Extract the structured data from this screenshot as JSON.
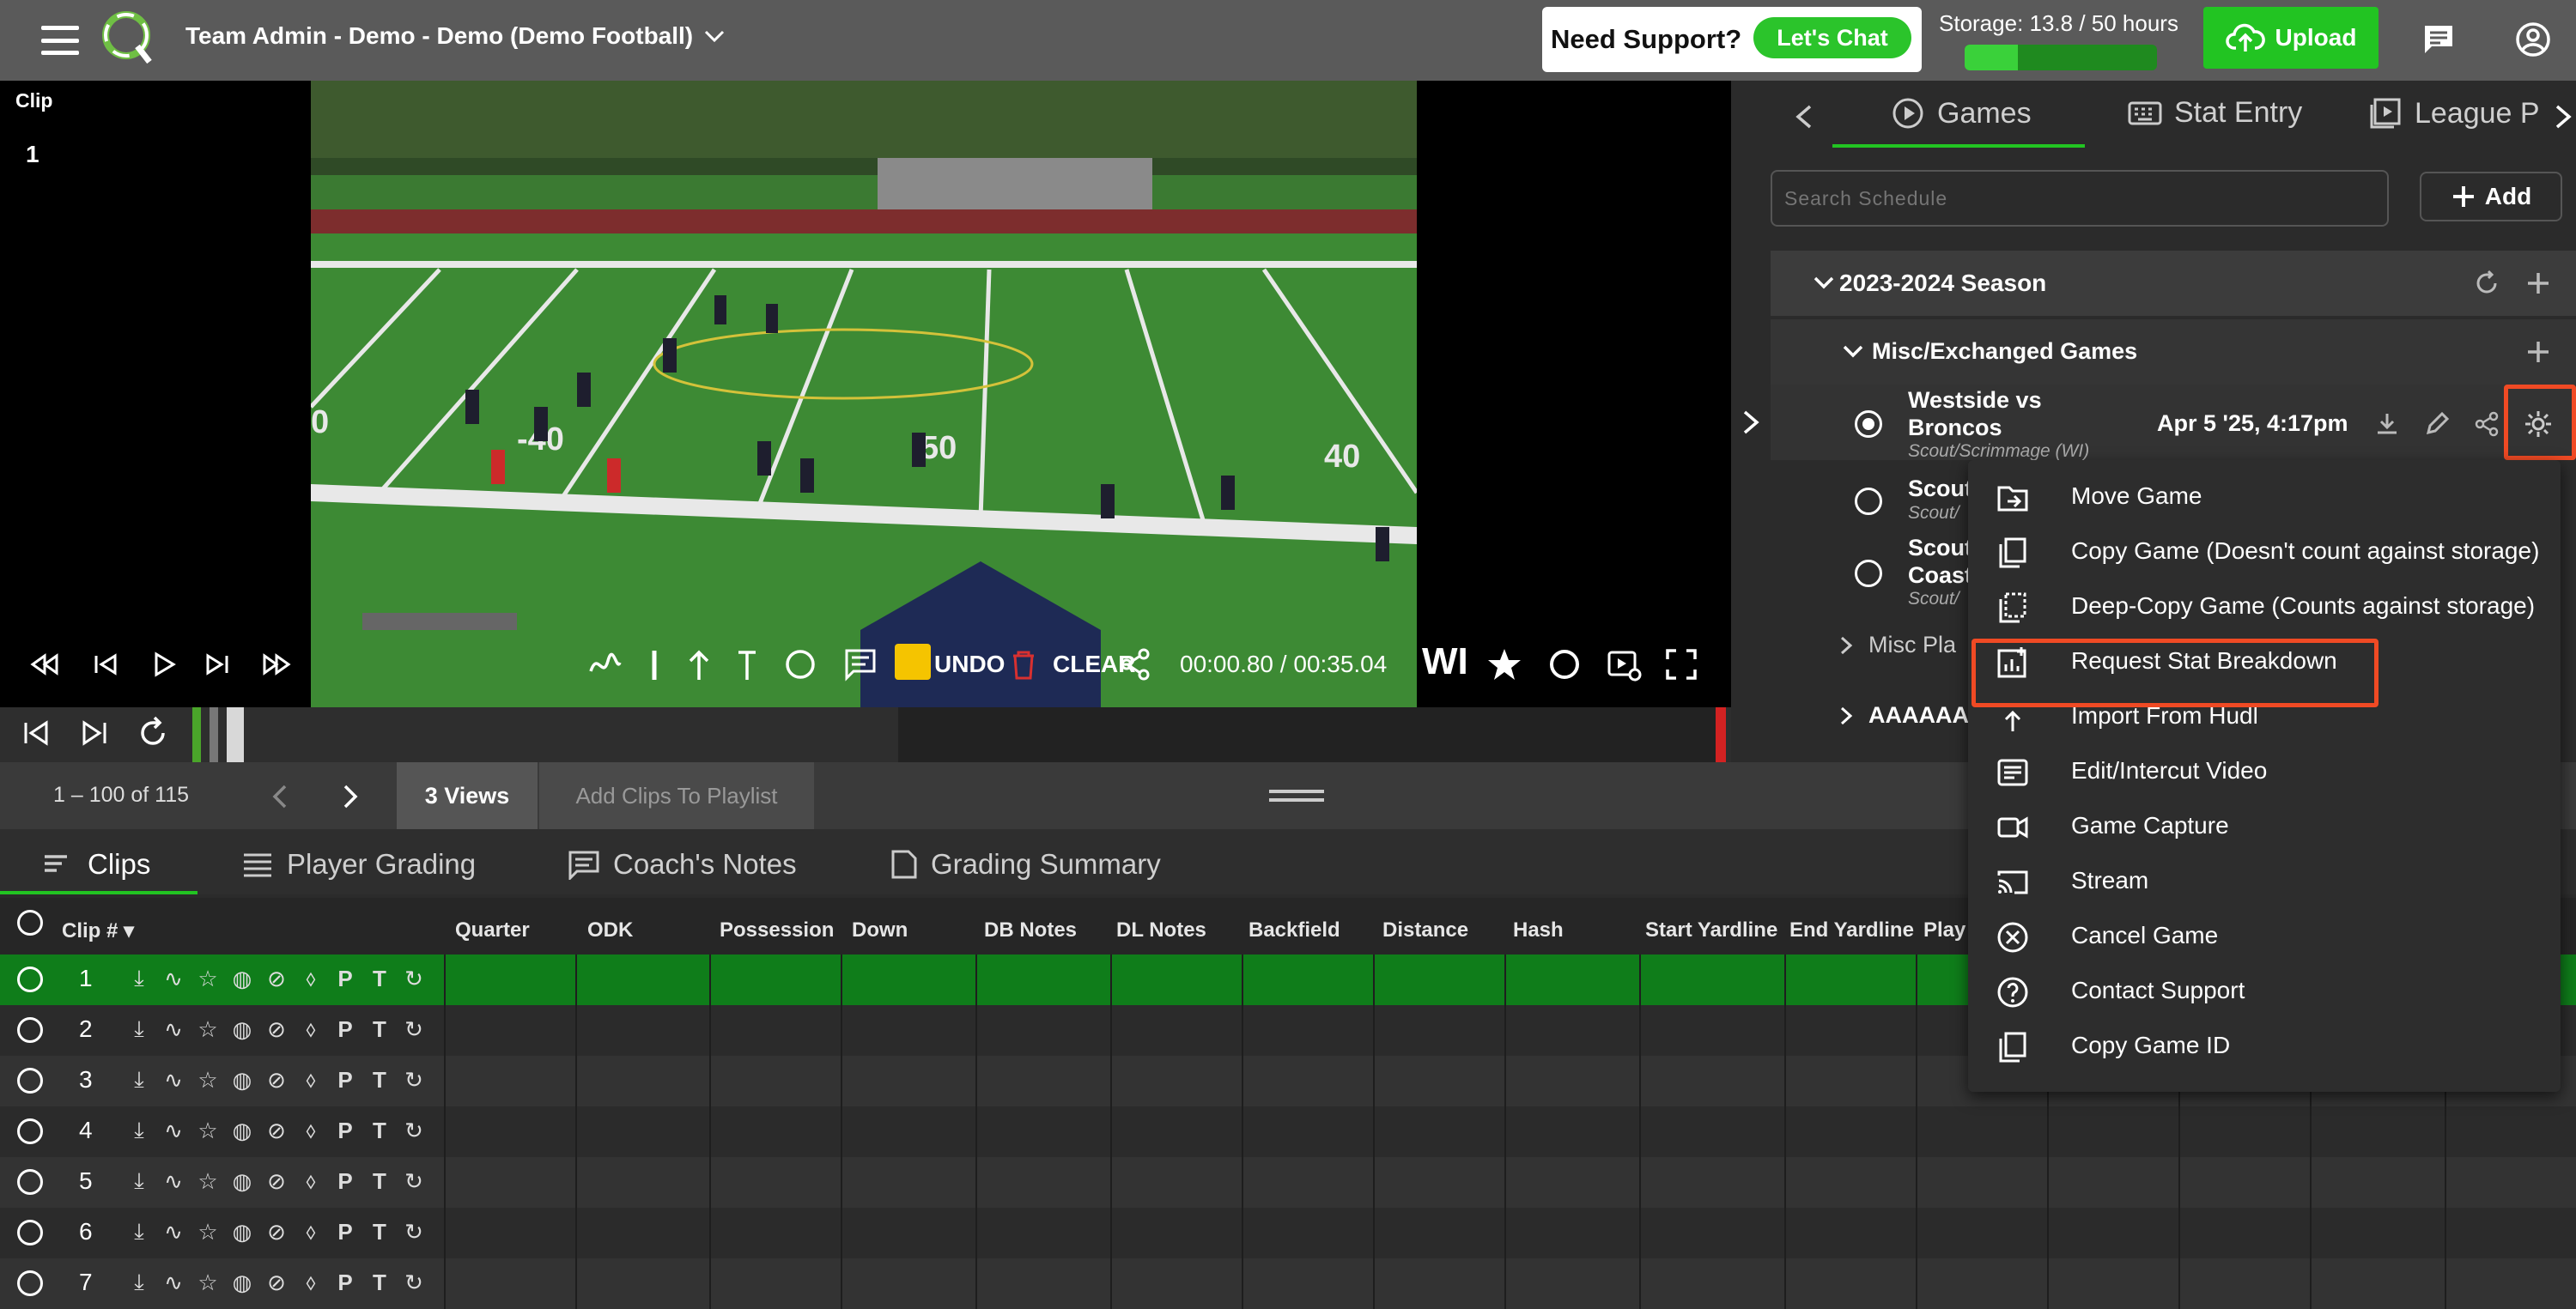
{
  "header": {
    "team_title": "Team Admin - Demo - Demo (Demo Football)",
    "support_label": "Need Support?",
    "chat_label": "Let's Chat",
    "storage_label": "Storage: 13.8 / 50 hours",
    "storage_fraction": 0.276,
    "upload_label": "Upload"
  },
  "player": {
    "clip_label": "Clip",
    "clip_number": "1",
    "undo_label": "UNDO",
    "clear_label": "CLEAR",
    "time_readout": "00:00.80 / 00:35.04",
    "wi_label": "WI",
    "field_numbers": [
      "40",
      "50",
      "40",
      "-40",
      "0"
    ]
  },
  "right_panel": {
    "tabs": [
      {
        "label": "Games"
      },
      {
        "label": "Stat Entry"
      },
      {
        "label": "League P"
      }
    ],
    "search_placeholder": "Search Schedule",
    "add_label": "Add",
    "season_label": "2023-2024 Season",
    "group_label": "Misc/Exchanged Games",
    "game": {
      "title_line1": "Westside vs",
      "title_line2": "Broncos",
      "subtitle": "Scout/Scrimmage (WI)",
      "date": "Apr 5 '25, 4:17pm"
    },
    "other_games": [
      {
        "line1": "Scout",
        "line2": "Scout/"
      },
      {
        "line1": "Scout",
        "line2": "Coast",
        "line3": "Scout/"
      }
    ],
    "misc_play_label": "Misc Pla",
    "aaa_label": "AAAAAA"
  },
  "menu": {
    "items": [
      {
        "label": "Move Game",
        "icon": "move-icon"
      },
      {
        "label": "Copy Game (Doesn't count against storage)",
        "icon": "copy-icon"
      },
      {
        "label": "Deep-Copy Game (Counts against storage)",
        "icon": "deep-copy-icon"
      },
      {
        "label": "Request Stat Breakdown",
        "icon": "stats-icon"
      },
      {
        "label": "Import From Hudl",
        "icon": "import-icon"
      },
      {
        "label": "Edit/Intercut Video",
        "icon": "edit-video-icon"
      },
      {
        "label": "Game Capture",
        "icon": "camera-icon"
      },
      {
        "label": "Stream",
        "icon": "cast-icon"
      },
      {
        "label": "Cancel Game",
        "icon": "cancel-icon"
      },
      {
        "label": "Contact Support",
        "icon": "help-icon"
      },
      {
        "label": "Copy Game ID",
        "icon": "copy-id-icon"
      }
    ]
  },
  "pager": {
    "range": "1 – 100 of 115",
    "views_label": "3 Views",
    "add_clips_label": "Add Clips To Playlist"
  },
  "bottom_tabs": [
    {
      "label": "Clips"
    },
    {
      "label": "Player Grading"
    },
    {
      "label": "Coach's Notes"
    },
    {
      "label": "Grading Summary"
    }
  ],
  "table": {
    "columns": [
      "Clip #",
      "Quarter",
      "ODK",
      "Possession",
      "Down",
      "DB Notes",
      "DL Notes",
      "Backfield",
      "Distance",
      "Hash",
      "Start Yardline",
      "End Yardline",
      "Play"
    ],
    "rows": [
      "1",
      "2",
      "3",
      "4",
      "5",
      "6",
      "7"
    ],
    "row_letters": [
      "P",
      "T"
    ]
  },
  "colors": {
    "accent": "#22c422",
    "highlight": "#f04a24",
    "selected_row": "#0f7d1a"
  }
}
